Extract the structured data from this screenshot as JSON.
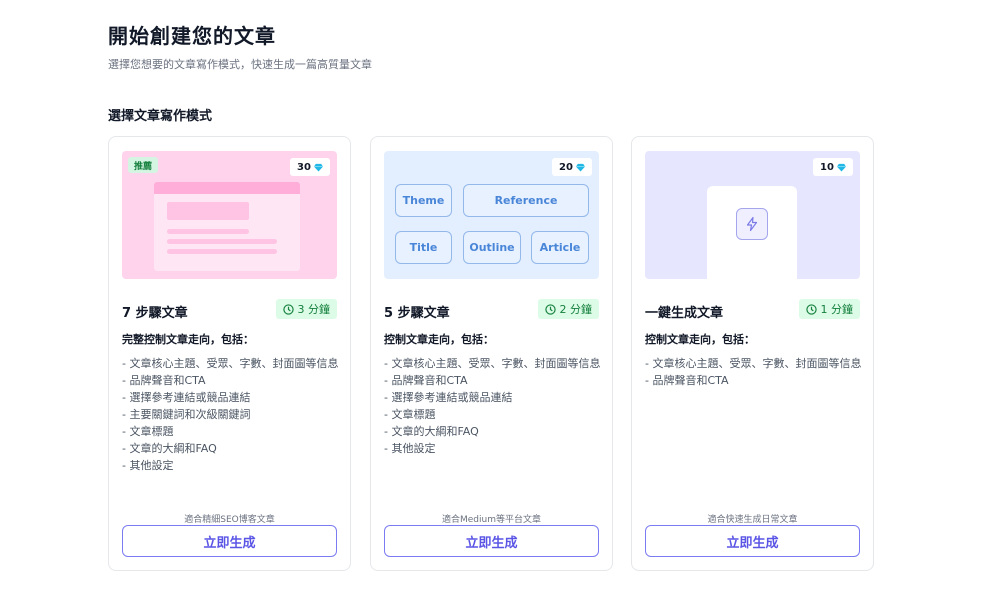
{
  "header": {
    "title": "開始創建您的文章",
    "subtitle": "選擇您想要的文章寫作模式，快速生成一篇高質量文章"
  },
  "section_title": "選擇文章寫作模式",
  "cards": [
    {
      "credits": "30",
      "badge": "推薦",
      "title": "7 步驟文章",
      "time": "3 分鐘",
      "desc": "完整控制文章走向，包括：",
      "features": [
        "- 文章核心主題、受眾、字數、封面圖等信息",
        "- 品牌聲音和CTA",
        "- 選擇參考連結或競品連結",
        "- 主要關鍵詞和次級關鍵詞",
        "- 文章標題",
        "- 文章的大綱和FAQ",
        "- 其他設定"
      ],
      "suitable": "適合精細SEO博客文章",
      "button": "立即生成"
    },
    {
      "credits": "20",
      "chips": [
        "Theme",
        "Reference",
        "Title",
        "Outline",
        "Article"
      ],
      "title": "5 步驟文章",
      "time": "2 分鐘",
      "desc": "控制文章走向，包括：",
      "features": [
        "- 文章核心主題、受眾、字數、封面圖等信息",
        "- 品牌聲音和CTA",
        "- 選擇參考連結或競品連結",
        "- 文章標題",
        "- 文章的大綱和FAQ",
        "- 其他設定"
      ],
      "suitable": "適合Medium等平台文章",
      "button": "立即生成"
    },
    {
      "credits": "10",
      "title": "一鍵生成文章",
      "time": "1 分鐘",
      "desc": "控制文章走向，包括：",
      "features": [
        "- 文章核心主題、受眾、字數、封面圖等信息",
        "- 品牌聲音和CTA"
      ],
      "suitable": "適合快速生成日常文章",
      "button": "立即生成"
    }
  ],
  "icons": {
    "credit": "diamond-gem-icon",
    "time": "clock-icon",
    "one_click": "lightning-bolt-icon"
  },
  "colors": {
    "accent": "#5b55e6",
    "gem": "#22b8e6",
    "time_badge_bg": "#dcfce7",
    "time_badge_text": "#15803d"
  }
}
